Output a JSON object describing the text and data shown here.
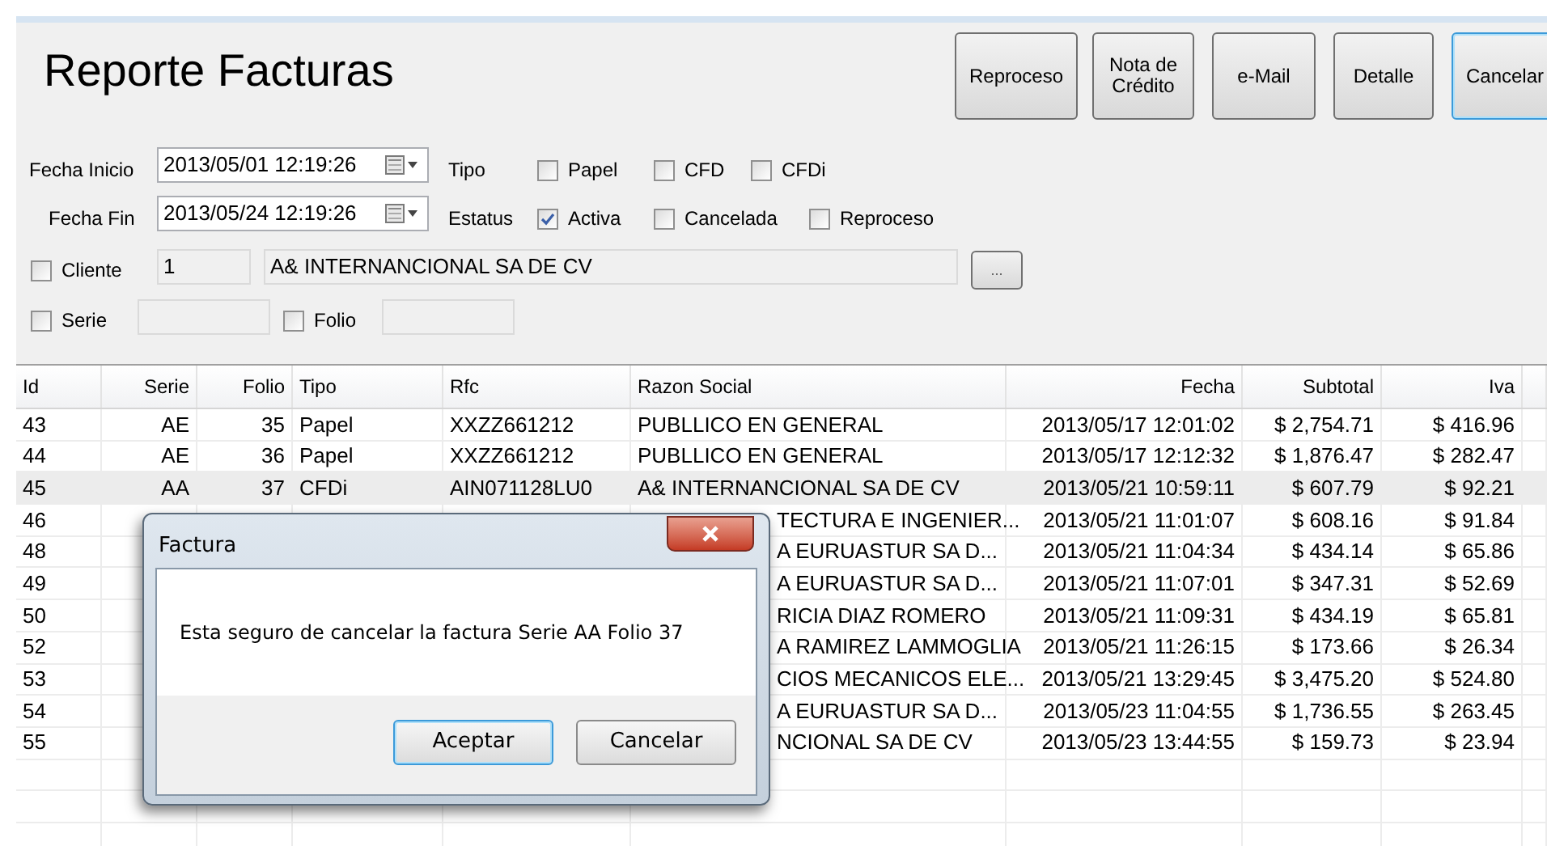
{
  "window": {
    "title": "Reporte Facturas"
  },
  "buttons": [
    {
      "label": "Reproceso",
      "focused": false
    },
    {
      "label": "Nota de Crédito",
      "focused": false
    },
    {
      "label": "e-Mail",
      "focused": false
    },
    {
      "label": "Detalle",
      "focused": false
    },
    {
      "label": "Cancelar",
      "focused": true
    }
  ],
  "filters": {
    "fecha_inicio": {
      "label": "Fecha Inicio",
      "value": "2013/05/01 12:19:26"
    },
    "fecha_fin": {
      "label": "Fecha Fin",
      "value": "2013/05/24 12:19:26"
    },
    "tipo": {
      "label": "Tipo",
      "options": [
        {
          "label": "Papel",
          "checked": false
        },
        {
          "label": "CFD",
          "checked": false
        },
        {
          "label": "CFDi",
          "checked": false
        }
      ]
    },
    "estatus": {
      "label": "Estatus",
      "options": [
        {
          "label": "Activa",
          "checked": true
        },
        {
          "label": "Cancelada",
          "checked": false
        },
        {
          "label": "Reproceso",
          "checked": false
        }
      ]
    },
    "cliente": {
      "label": "Cliente",
      "checked": false,
      "id": "1",
      "name": "A& INTERNANCIONAL SA DE CV",
      "browse_button": "..."
    },
    "serie": {
      "label": "Serie",
      "checked": false
    },
    "folio": {
      "label": "Folio",
      "checked": false
    }
  },
  "table": {
    "columns": [
      "Id",
      "Serie",
      "Folio",
      "Tipo",
      "Rfc",
      "Razon Social",
      "Fecha",
      "Subtotal",
      "Iva"
    ],
    "rows": [
      {
        "id": "43",
        "serie": "AE",
        "folio": "35",
        "tipo": "Papel",
        "rfc": "XXZZ661212",
        "razon_social": "PUBLLICO EN GENERAL",
        "fecha": "2013/05/17 12:01:02",
        "subtotal": "$ 2,754.71",
        "iva": "$ 416.96",
        "selected": false
      },
      {
        "id": "44",
        "serie": "AE",
        "folio": "36",
        "tipo": "Papel",
        "rfc": "XXZZ661212",
        "razon_social": "PUBLLICO EN GENERAL",
        "fecha": "2013/05/17 12:12:32",
        "subtotal": "$ 1,876.47",
        "iva": "$ 282.47",
        "selected": false
      },
      {
        "id": "45",
        "serie": "AA",
        "folio": "37",
        "tipo": "CFDi",
        "rfc": "AIN071128LU0",
        "razon_social": "A& INTERNANCIONAL SA DE CV",
        "fecha": "2013/05/21 10:59:11",
        "subtotal": "$ 607.79",
        "iva": "$ 92.21",
        "selected": true
      },
      {
        "id": "46",
        "razon_social": "TECTURA E INGENIER...",
        "fecha": "2013/05/21 11:01:07",
        "subtotal": "$ 608.16",
        "iva": "$ 91.84",
        "selected": false
      },
      {
        "id": "48",
        "razon_social": "A EURUASTUR SA D...",
        "fecha": "2013/05/21 11:04:34",
        "subtotal": "$ 434.14",
        "iva": "$ 65.86",
        "selected": false
      },
      {
        "id": "49",
        "razon_social": "A EURUASTUR SA D...",
        "fecha": "2013/05/21 11:07:01",
        "subtotal": "$ 347.31",
        "iva": "$ 52.69",
        "selected": false
      },
      {
        "id": "50",
        "razon_social": "RICIA DIAZ ROMERO",
        "fecha": "2013/05/21 11:09:31",
        "subtotal": "$ 434.19",
        "iva": "$ 65.81",
        "selected": false
      },
      {
        "id": "52",
        "razon_social": "A RAMIREZ LAMMOGLIA",
        "fecha": "2013/05/21 11:26:15",
        "subtotal": "$ 173.66",
        "iva": "$ 26.34",
        "selected": false
      },
      {
        "id": "53",
        "razon_social": "CIOS MECANICOS ELE...",
        "fecha": "2013/05/21 13:29:45",
        "subtotal": "$ 3,475.20",
        "iva": "$ 524.80",
        "selected": false
      },
      {
        "id": "54",
        "razon_social": "A EURUASTUR SA D...",
        "fecha": "2013/05/23 11:04:55",
        "subtotal": "$ 1,736.55",
        "iva": "$ 263.45",
        "selected": false
      },
      {
        "id": "55",
        "razon_social": "NCIONAL SA DE CV",
        "fecha": "2013/05/23 13:44:55",
        "subtotal": "$ 159.73",
        "iva": "$ 23.94",
        "selected": false
      }
    ]
  },
  "dialog": {
    "title": "Factura",
    "message": "Esta seguro de cancelar la factura Serie AA Folio 37",
    "buttons": [
      {
        "label": "Aceptar",
        "focused": true
      },
      {
        "label": "Cancelar",
        "focused": false
      }
    ]
  }
}
